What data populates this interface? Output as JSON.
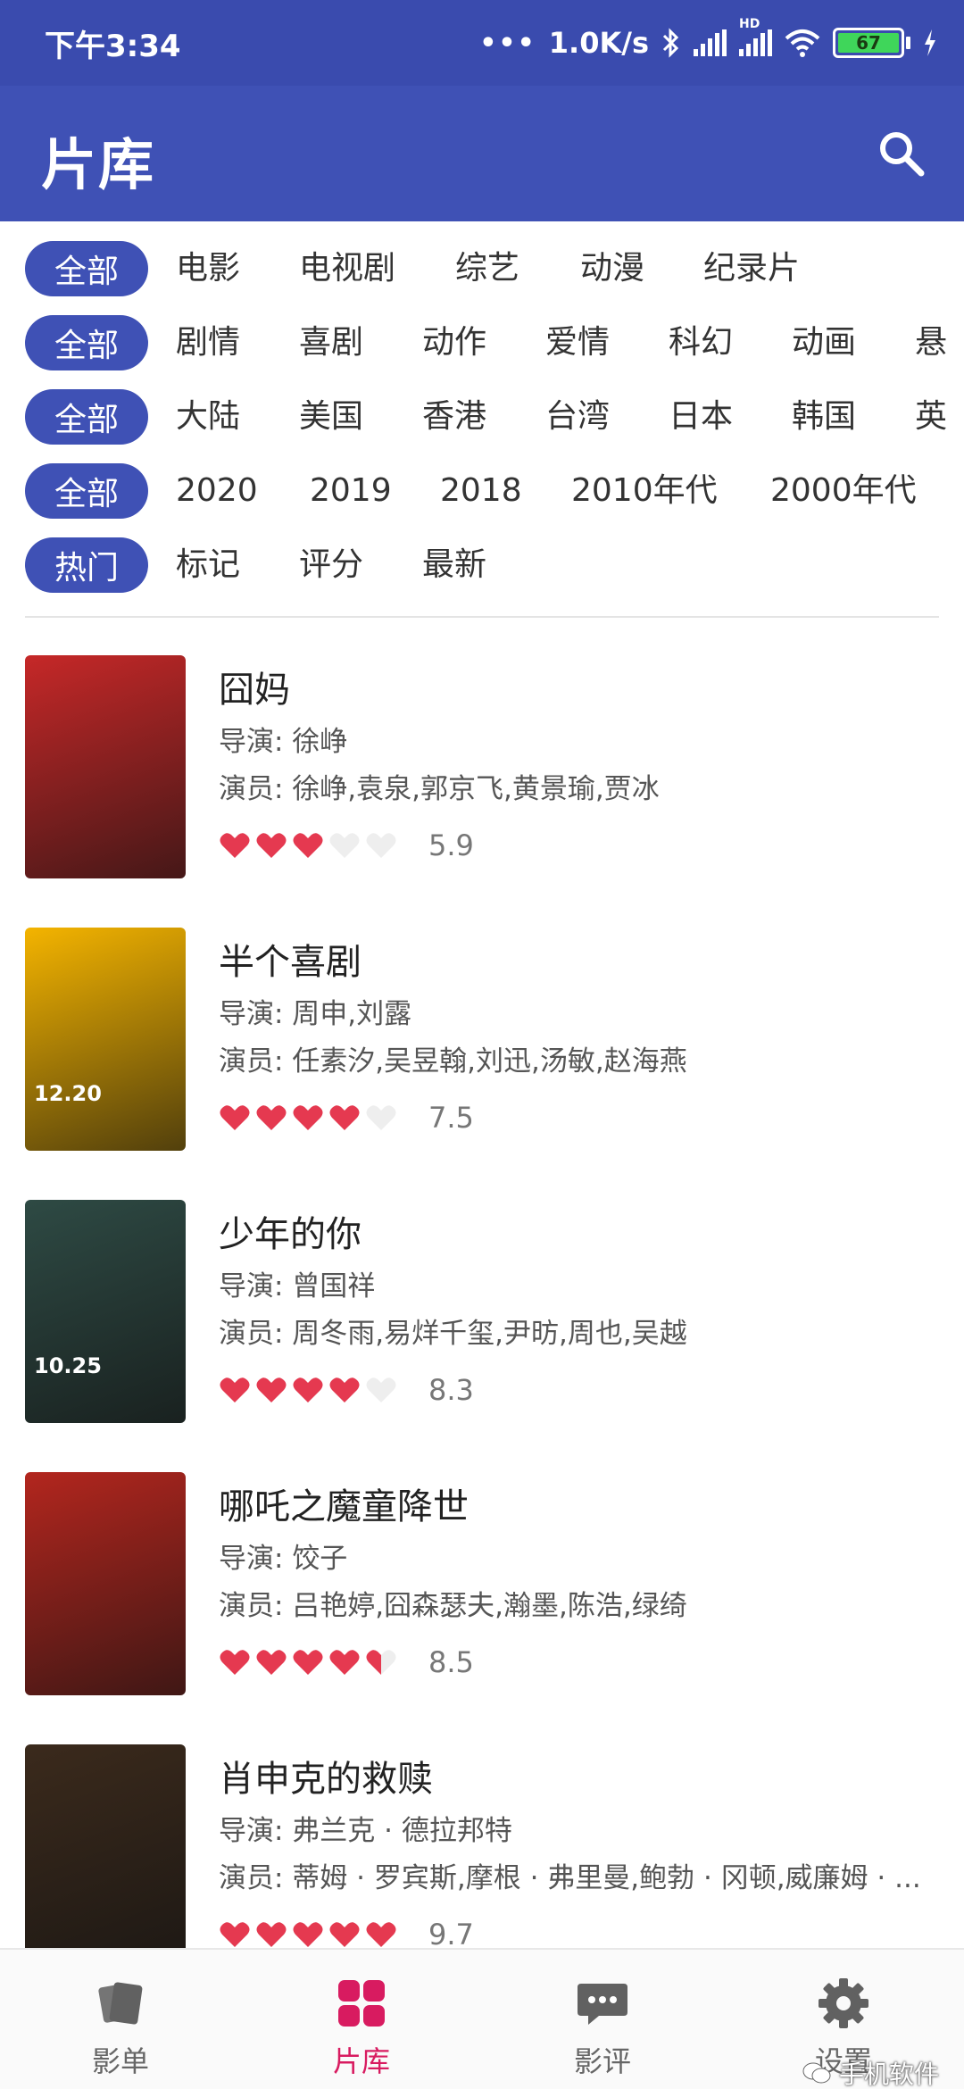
{
  "status_bar": {
    "time": "下午3:34",
    "network_speed": "1.0K/s",
    "hd_label": "HD",
    "battery": "67"
  },
  "app_bar": {
    "title": "片库",
    "search_icon": "search-icon"
  },
  "filters": [
    {
      "active": "全部",
      "options": [
        "电影",
        "电视剧",
        "综艺",
        "动漫",
        "纪录片"
      ]
    },
    {
      "active": "全部",
      "options": [
        "剧情",
        "喜剧",
        "动作",
        "爱情",
        "科幻",
        "动画",
        "悬"
      ]
    },
    {
      "active": "全部",
      "options": [
        "大陆",
        "美国",
        "香港",
        "台湾",
        "日本",
        "韩国",
        "英"
      ]
    },
    {
      "active": "全部",
      "options": [
        "2020",
        "2019",
        "2018",
        "2010年代",
        "2000年代"
      ]
    },
    {
      "active": "热门",
      "options": [
        "标记",
        "评分",
        "最新"
      ]
    }
  ],
  "movies": [
    {
      "title": "囧妈",
      "director": "导演: 徐峥",
      "cast": "演员: 徐峥,袁泉,郭京飞,黄景瑜,贾冰",
      "stars": 3,
      "score": "5.9",
      "poster_color": "#c62828"
    },
    {
      "title": "半个喜剧",
      "director": "导演: 周申,刘露",
      "cast": "演员: 任素汐,吴昱翰,刘迅,汤敏,赵海燕",
      "stars": 4,
      "score": "7.5",
      "poster_color": "#f4b400",
      "poster_date": "12.20"
    },
    {
      "title": "少年的你",
      "director": "导演: 曾国祥",
      "cast": "演员: 周冬雨,易烊千玺,尹昉,周也,吴越",
      "stars": 4,
      "score": "8.3",
      "poster_color": "#2e4a44",
      "poster_date": "10.25"
    },
    {
      "title": "哪吒之魔童降世",
      "director": "导演: 饺子",
      "cast": "演员: 吕艳婷,囧森瑟夫,瀚墨,陈浩,绿绮",
      "stars": 4.5,
      "score": "8.5",
      "poster_color": "#b3261e"
    },
    {
      "title": "肖申克的救赎",
      "director": "导演: 弗兰克 · 德拉邦特",
      "cast": "演员: 蒂姆 · 罗宾斯,摩根 · 弗里曼,鲍勃 · 冈顿,威廉姆 · ...",
      "stars": 5,
      "score": "9.7",
      "poster_color": "#3b2a1c"
    }
  ],
  "bottom_nav": [
    {
      "label": "影单",
      "icon": "cards-icon",
      "active": false
    },
    {
      "label": "片库",
      "icon": "grid-icon",
      "active": true
    },
    {
      "label": "影评",
      "icon": "chat-bubble-icon",
      "active": false
    },
    {
      "label": "设置",
      "icon": "gear-icon",
      "active": false
    }
  ],
  "watermark": "手机软件",
  "colors": {
    "primary": "#3f51b5",
    "status_bar": "#3a4bae",
    "accent": "#d81b60",
    "heart_full": "#e53950",
    "heart_empty": "#eeeeee"
  }
}
